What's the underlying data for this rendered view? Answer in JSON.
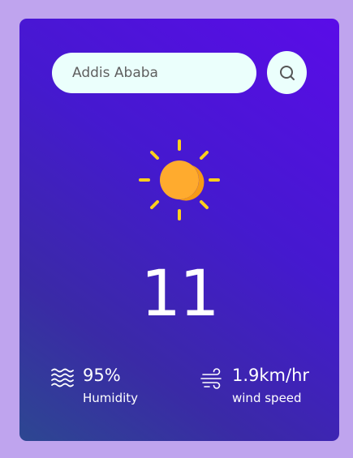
{
  "search": {
    "value": "Addis Ababa",
    "icon": "search-icon"
  },
  "weather": {
    "icon": "sun-icon",
    "temperature": "11"
  },
  "humidity": {
    "icon": "waves-icon",
    "value": "95%",
    "label": "Humidity"
  },
  "wind": {
    "icon": "wind-icon",
    "value": "1.9km/hr",
    "label": "wind speed"
  },
  "colors": {
    "page_background": "#bfa4ee",
    "card_gradient_top": "#5a0ce8",
    "card_gradient_bottom": "#2d4791",
    "input_background": "#ebfffc",
    "sun": "#ffab2e",
    "sun_rays": "#ffcf1c",
    "text": "#ffffff"
  }
}
